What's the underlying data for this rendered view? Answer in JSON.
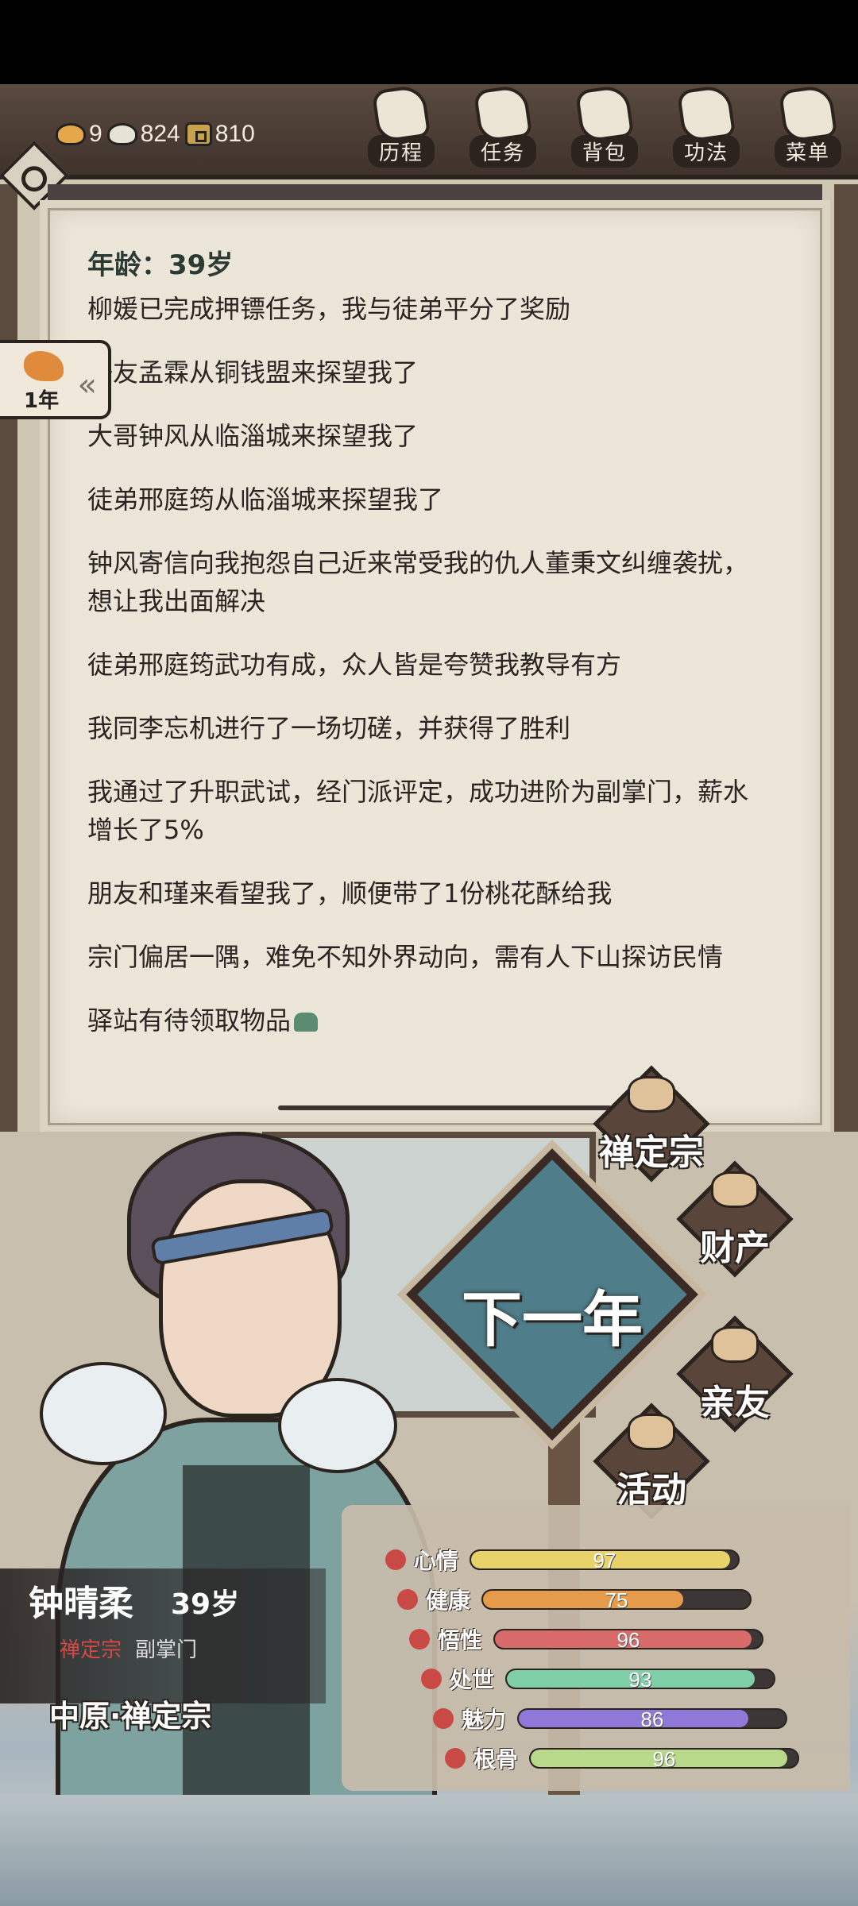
{
  "resources": {
    "gold": "9",
    "silver": "824",
    "coins": "810"
  },
  "nav": {
    "history": "历程",
    "tasks": "任务",
    "bag": "背包",
    "skills": "功法",
    "menu": "菜单"
  },
  "year_tab": {
    "label": "1年",
    "arrow": "«"
  },
  "log": {
    "age_line": "年龄：39岁",
    "entries": [
      "柳媛已完成押镖任务，我与徒弟平分了奖励",
      "好友孟霖从铜钱盟来探望我了",
      "大哥钟风从临淄城来探望我了",
      "徒弟邢庭筠从临淄城来探望我了",
      "钟风寄信向我抱怨自己近来常受我的仇人董秉文纠缠袭扰，想让我出面解决",
      "徒弟邢庭筠武功有成，众人皆是夸赞我教导有方",
      "我同李忘机进行了一场切磋，并获得了胜利",
      "我通过了升职武试，经门派评定，成功进阶为副掌门，薪水增长了5%",
      "朋友和瑾来看望我了，顺便带了1份桃花酥给我",
      "宗门偏居一隅，难免不知外界动向，需有人下山探访民情",
      "驿站有待领取物品"
    ]
  },
  "actions": {
    "next_year": "下一年",
    "sect": "禅定宗",
    "property": "财产",
    "relatives": "亲友",
    "activity": "活动"
  },
  "character": {
    "name": "钟晴柔",
    "age": "39岁",
    "sect": "禅定宗",
    "rank": "副掌门",
    "location": "中原·禅定宗"
  },
  "stats": [
    {
      "label": "心情",
      "value": 97,
      "color": "#e8d26a",
      "icon_color": "#c94a45",
      "icon": "face-icon"
    },
    {
      "label": "健康",
      "value": 75,
      "color": "#e59b4a",
      "icon_color": "#c94a45",
      "icon": "heart-icon"
    },
    {
      "label": "悟性",
      "value": 96,
      "color": "#d86a6a",
      "icon_color": "#c94a45",
      "icon": "bulb-icon"
    },
    {
      "label": "处世",
      "value": 93,
      "color": "#7fd0a8",
      "icon_color": "#c94a45",
      "icon": "flower-icon"
    },
    {
      "label": "魅力",
      "value": 86,
      "color": "#8f78d8",
      "icon_color": "#c94a45",
      "icon": "brush-icon"
    },
    {
      "label": "根骨",
      "value": 96,
      "color": "#b8d88a",
      "icon_color": "#c94a45",
      "icon": "lotus-icon"
    }
  ]
}
